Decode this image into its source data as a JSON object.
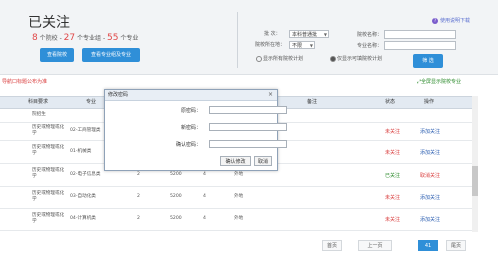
{
  "header": {
    "title": "已关注",
    "count_schools": "8",
    "label_schools": "个院校 -",
    "count_groups": "27",
    "label_groups": "个专业组 -",
    "count_majors": "55",
    "label_majors": "个专业",
    "btn_view_schools": "查看院校",
    "btn_view_groups": "查看专业组及专业",
    "help": "使用说明下载"
  },
  "filters": {
    "batch_label": "批 次：",
    "batch_value": "本科普通批",
    "location_label": "院校所在地：",
    "location_value": "不限",
    "school_name_label": "院校名称：",
    "major_name_label": "专业名称：",
    "radio_all": "显示所有院校计划",
    "radio_valid": "仅显示可填院校计划",
    "filter_btn": "筛 选"
  },
  "links": {
    "red": "导航口标题公布为准",
    "green": "全屏显示院校专业"
  },
  "table": {
    "headers": [
      "科目要求",
      "专业",
      "备注",
      "状态",
      "操作"
    ],
    "rows": [
      {
        "subject": "院招生",
        "major": "",
        "count": "",
        "fee": "",
        "years": "",
        "note": "",
        "status": "",
        "op": ""
      },
      {
        "subject": "历史或物理或化学",
        "major": "02-工商管理类",
        "count": "",
        "fee": "",
        "years": "",
        "note": "",
        "status": "未关注",
        "op": "添加关注"
      },
      {
        "subject": "历史或物理或化学",
        "major": "01-机械类",
        "count": "",
        "fee": "",
        "years": "",
        "note": "",
        "status": "未关注",
        "op": "添加关注"
      },
      {
        "subject": "历史或物理或化学",
        "major": "02-电子信息类",
        "count": "2",
        "fee": "5200",
        "years": "4",
        "note": "外地",
        "status": "已关注",
        "op": "取消关注"
      },
      {
        "subject": "历史或物理或化学",
        "major": "03-自动化类",
        "count": "2",
        "fee": "5200",
        "years": "4",
        "note": "外地",
        "status": "未关注",
        "op": "添加关注"
      },
      {
        "subject": "历史或物理或化学",
        "major": "04-计算机类",
        "count": "2",
        "fee": "5200",
        "years": "4",
        "note": "外地",
        "status": "未关注",
        "op": "添加关注"
      }
    ]
  },
  "pager": {
    "first": "首页",
    "prev": "上一页",
    "current": "41",
    "last": "尾页"
  },
  "dialog": {
    "title": "修改密码",
    "close": "×",
    "old_label": "原密码：",
    "new_label": "新密码：",
    "confirm_label": "确认密码：",
    "ok_btn": "确认修改",
    "cancel_btn": "取消"
  },
  "colors": {
    "accent": "#2f8fd8",
    "count_red": "#e04848",
    "followed_green": "#2a8a2a",
    "unfollowed_red": "#d93a3a"
  }
}
